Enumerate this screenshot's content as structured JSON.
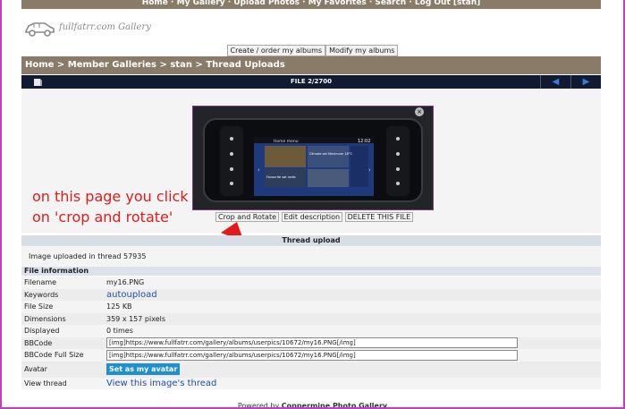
{
  "top_nav": {
    "items": [
      "Home",
      "My Gallery",
      "Upload Photos",
      "My Favorites",
      "Search",
      "Log Out [stan]"
    ],
    "separator": " · "
  },
  "logo": {
    "text": "fullfatrr.com Gallery",
    "icon": "car-icon"
  },
  "album_buttons": {
    "create": "Create / order my albums",
    "modify": "Modify my albums"
  },
  "breadcrumb": {
    "home": "Home",
    "member_galleries": "Member Galleries",
    "user": "stan",
    "album": "Thread Uploads",
    "sep": " > "
  },
  "file_bar": {
    "label": "FILE 2/2700",
    "return_icon": "return-to-thumbnails-icon",
    "prev_icon": "prev-arrow-icon",
    "next_icon": "next-arrow-icon"
  },
  "photo": {
    "screen_title": "Home menu",
    "screen_time": "12:02",
    "tile_text_1": "Climate set Maximum 18°C",
    "tile_text_2": "Favourite sat radio",
    "close_icon": "×"
  },
  "photo_actions": {
    "crop": "Crop and Rotate",
    "edit": "Edit description",
    "delete": "DELETE THIS FILE"
  },
  "annotation": {
    "line1": "on this page you click",
    "line2": "on 'crop and rotate'"
  },
  "thread": {
    "title": "Thread upload",
    "text": "Image uploaded in thread 57935"
  },
  "file_info": {
    "heading": "File information",
    "rows": {
      "filename_k": "Filename",
      "filename_v": "my16.PNG",
      "keywords_k": "Keywords",
      "keywords_v": "autoupload",
      "filesize_k": "File Size",
      "filesize_v": "125 KB",
      "dimensions_k": "Dimensions",
      "dimensions_v": "359 x 157 pixels",
      "displayed_k": "Displayed",
      "displayed_v": "0 times",
      "bbcode_k": "BBCode",
      "bbcode_v": "[img]https://www.fullfatrr.com/gallery/albums/userpics/10672/my16.PNG[/img]",
      "bbcode_full_k": "BBCode Full Size",
      "bbcode_full_v": "[img]https://www.fullfatrr.com/gallery/albums/userpics/10672/my16.PNG[/img]",
      "avatar_k": "Avatar",
      "avatar_btn": "Set as my avatar",
      "view_thread_k": "View thread",
      "view_thread_v": "View this image's thread"
    }
  },
  "footer": {
    "prefix": "Powered by",
    "name": "Coppermine Photo Gallery"
  },
  "colors": {
    "header_bar": "#8a7a68",
    "file_bar": "#0f1b33",
    "annotation": "#e11b1b",
    "link": "#1f4fa8",
    "avatar_button": "#1f8fcf"
  }
}
